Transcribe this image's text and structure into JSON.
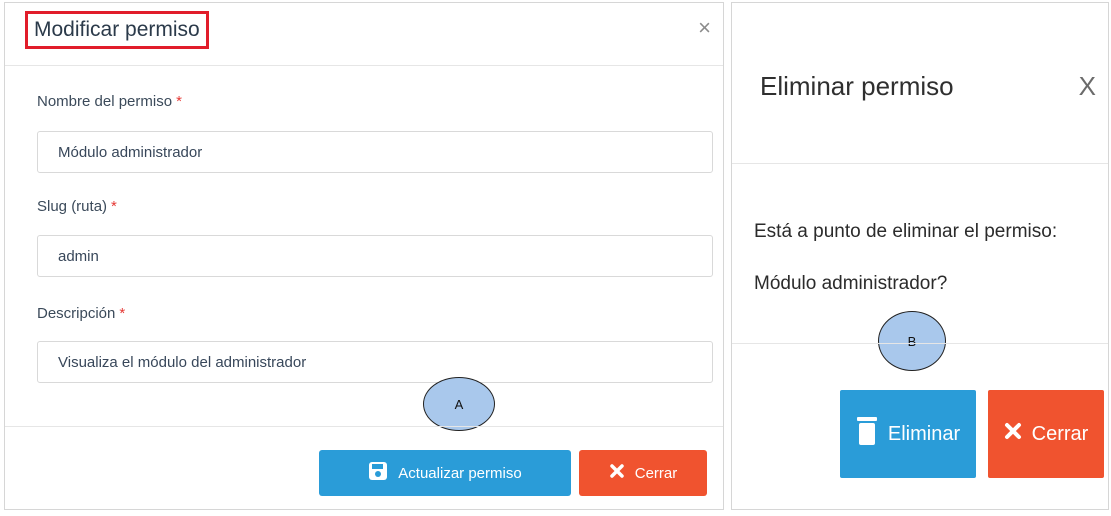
{
  "modal_a": {
    "title": "Modificar permiso",
    "close_icon": "×",
    "fields": {
      "name": {
        "label": "Nombre del permiso",
        "required_mark": "*",
        "value": "Módulo administrador"
      },
      "slug": {
        "label": "Slug (ruta)",
        "required_mark": "*",
        "value": "admin"
      },
      "description": {
        "label": "Descripción",
        "required_mark": "*",
        "value": "Visualiza el módulo del administrador"
      }
    },
    "update_button": {
      "label": "Actualizar permiso",
      "icon": "save-icon"
    },
    "close_button": {
      "label": "Cerrar",
      "icon": "x-icon"
    },
    "marker": "A"
  },
  "modal_b": {
    "title": "Eliminar permiso",
    "close_icon": "X",
    "message": "Está a punto de eliminar el permiso:",
    "item": "Módulo administrador?",
    "delete_button": {
      "label": "Eliminar",
      "icon": "trash-icon"
    },
    "close_button": {
      "label": "Cerrar",
      "icon": "x-icon"
    },
    "marker": "B"
  },
  "colors": {
    "primary": "#2a9cd8",
    "danger": "#f0532f",
    "highlight": "#e11d2a",
    "required": "#e53935",
    "marker_fill": "#a9c8ec"
  }
}
